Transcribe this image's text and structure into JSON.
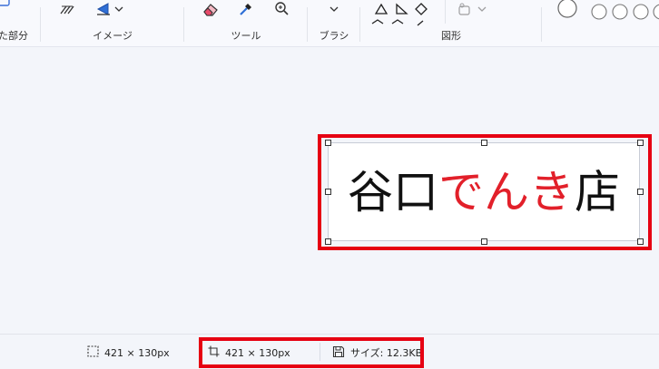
{
  "ribbon": {
    "groups": [
      {
        "id": "selection",
        "label": "た部分"
      },
      {
        "id": "image",
        "label": "イメージ"
      },
      {
        "id": "tools",
        "label": "ツール"
      },
      {
        "id": "brushes",
        "label": "ブラシ"
      },
      {
        "id": "shapes",
        "label": "図形"
      }
    ]
  },
  "canvas": {
    "image_text_parts": [
      {
        "text": "谷口",
        "color": "#111111"
      },
      {
        "text": "でんき",
        "color": "#e2202a"
      },
      {
        "text": "店",
        "color": "#111111"
      }
    ]
  },
  "statusbar": {
    "selection_size": "421 × 130px",
    "canvas_size": "421 × 130px",
    "file_size": "サイズ: 12.3KB"
  },
  "colors": {
    "highlight": "#e60012",
    "accent_red": "#e2202a"
  }
}
